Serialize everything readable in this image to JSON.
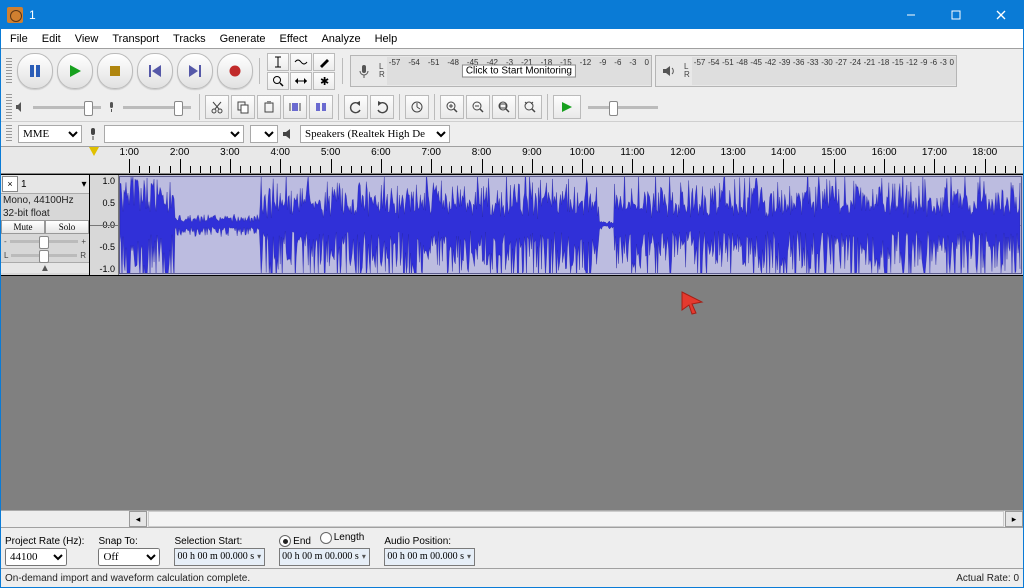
{
  "title": "1",
  "menus": [
    "File",
    "Edit",
    "View",
    "Transport",
    "Tracks",
    "Generate",
    "Effect",
    "Analyze",
    "Help"
  ],
  "meter": {
    "rec_hint": "Click to Start Monitoring",
    "ticks": [
      "-57",
      "-54",
      "-51",
      "-48",
      "-45",
      "-42",
      "-3",
      "-21",
      "-18",
      "-15",
      "-12",
      "-9",
      "-6",
      "-3",
      "0"
    ],
    "ticks_play": [
      "-57",
      "-54",
      "-51",
      "-48",
      "-45",
      "-42",
      "-39",
      "-36",
      "-33",
      "-30",
      "-27",
      "-24",
      "-21",
      "-18",
      "-15",
      "-12",
      "-9",
      "-6",
      "-3",
      "0"
    ]
  },
  "device": {
    "host": "MME",
    "out": "Speakers (Realtek High De"
  },
  "timeline": {
    "labels": [
      "1:00",
      "2:00",
      "3:00",
      "4:00",
      "5:00",
      "6:00",
      "7:00",
      "8:00",
      "9:00",
      "10:00",
      "11:00",
      "12:00",
      "13:00",
      "14:00",
      "15:00",
      "16:00",
      "17:00",
      "18:00"
    ]
  },
  "track": {
    "name": "1",
    "info1": "Mono, 44100Hz",
    "info2": "32-bit float",
    "mute": "Mute",
    "solo": "Solo",
    "ruler": [
      "1.0",
      "0.5",
      "0.0",
      "-0.5",
      "-1.0"
    ]
  },
  "selection": {
    "rate_label": "Project Rate (Hz):",
    "rate": "44100",
    "snap_label": "Snap To:",
    "snap": "Off",
    "start_label": "Selection Start:",
    "end_label": "End",
    "length_label": "Length",
    "pos_label": "Audio Position:",
    "time": "00 h 00 m 00.000 s"
  },
  "status": {
    "left": "On-demand import and waveform calculation complete.",
    "right": "Actual Rate: 0"
  },
  "lr": {
    "l": "L",
    "r": "R"
  }
}
